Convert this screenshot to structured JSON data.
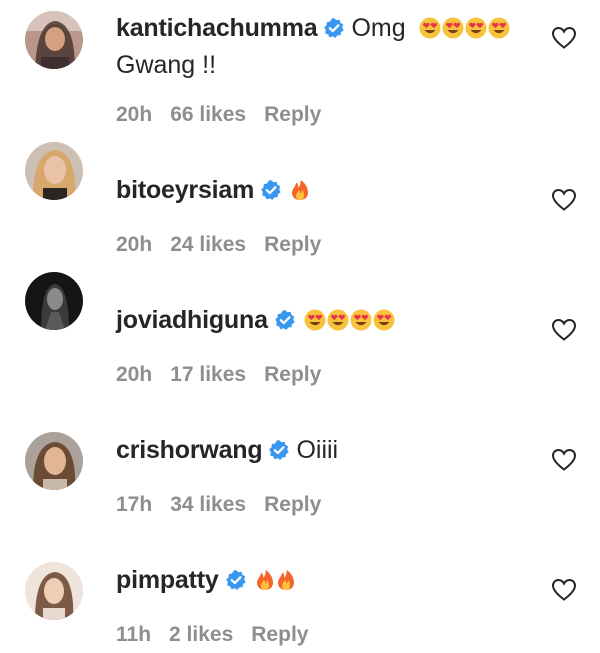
{
  "comments": [
    {
      "username": "kantichachumma",
      "verified": true,
      "text": "Omg",
      "text_line2": "Gwang !!",
      "emoji": [
        "heart-eyes",
        "heart-eyes",
        "heart-eyes",
        "heart-eyes"
      ],
      "time": "20h",
      "likes": "66 likes",
      "reply": "Reply"
    },
    {
      "username": "bitoeyrsiam",
      "verified": true,
      "text": "",
      "emoji": [
        "fire"
      ],
      "time": "20h",
      "likes": "24 likes",
      "reply": "Reply"
    },
    {
      "username": "joviadhiguna",
      "verified": true,
      "text": "",
      "emoji": [
        "heart-eyes",
        "heart-eyes",
        "heart-eyes",
        "heart-eyes"
      ],
      "time": "20h",
      "likes": "17 likes",
      "reply": "Reply"
    },
    {
      "username": "crishorwang",
      "verified": true,
      "text": "Oiiii",
      "emoji": [],
      "time": "17h",
      "likes": "34 likes",
      "reply": "Reply"
    },
    {
      "username": "pimpatty",
      "verified": true,
      "text": "",
      "emoji": [
        "fire",
        "fire"
      ],
      "time": "11h",
      "likes": "2 likes",
      "reply": "Reply"
    }
  ],
  "colors": {
    "text": "#262626",
    "meta": "#8e8e8e",
    "verified_badge": "#3897f0",
    "emoji_face": "#f7c23c",
    "emoji_heart": "#e8334a",
    "fire_outer": "#f5652a",
    "fire_inner": "#fcc23d"
  },
  "icons": {
    "verified": "verified-badge-icon",
    "like": "heart-outline-icon",
    "heart_eyes": "heart-eyes-emoji",
    "fire": "fire-emoji"
  }
}
